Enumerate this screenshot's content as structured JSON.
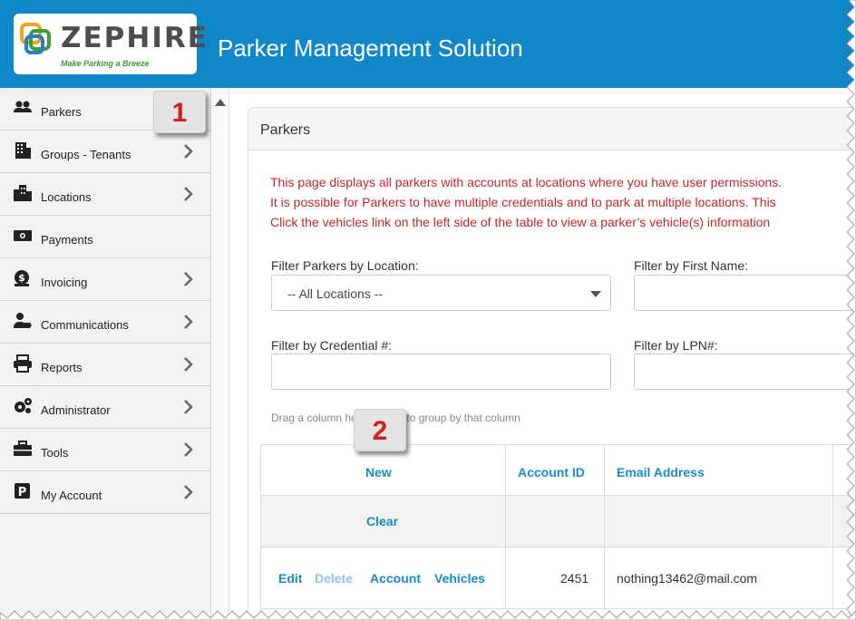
{
  "header": {
    "brand": "ZEPHIRE",
    "tagline": "Make Parking a Breeze",
    "title": "Parker Management Solution"
  },
  "sidebar": {
    "items": [
      {
        "label": "Parkers",
        "icon": "users-icon",
        "has_children": false
      },
      {
        "label": "Groups - Tenants",
        "icon": "building-icon",
        "has_children": true
      },
      {
        "label": "Locations",
        "icon": "city-icon",
        "has_children": true
      },
      {
        "label": "Payments",
        "icon": "money-icon",
        "has_children": false
      },
      {
        "label": "Invoicing",
        "icon": "invoice-dollar-icon",
        "has_children": true
      },
      {
        "label": "Communications",
        "icon": "user-tag-icon",
        "has_children": true
      },
      {
        "label": "Reports",
        "icon": "printer-icon",
        "has_children": true
      },
      {
        "label": "Administrator",
        "icon": "cogs-icon",
        "has_children": true
      },
      {
        "label": "Tools",
        "icon": "toolbox-icon",
        "has_children": true
      },
      {
        "label": "My Account",
        "icon": "parking-icon",
        "has_children": true
      }
    ]
  },
  "callouts": {
    "one": "1",
    "two": "2"
  },
  "panel": {
    "title": "Parkers",
    "notices": [
      "This page displays all parkers with accounts at locations where you have user permissions.",
      "It is possible for Parkers to have multiple credentials and to park at multiple locations. This",
      "Click the vehicles link on the left side of the table to view a parker’s vehicle(s) information"
    ],
    "filters": {
      "location_label": "Filter Parkers by Location:",
      "location_value": "-- All Locations --",
      "first_name_label": "Filter by First Name:",
      "first_name_value": "",
      "credential_label": "Filter by Credential #:",
      "credential_value": "",
      "lpn_label": "Filter by LPN#:",
      "lpn_value": ""
    },
    "group_hint": "Drag a column header here to group by that column",
    "grid": {
      "new_label": "New",
      "clear_label": "Clear",
      "columns": [
        "Account ID",
        "Email Address"
      ],
      "rows": [
        {
          "actions": [
            "Edit",
            "Delete",
            "Account",
            "Vehicles"
          ],
          "account_id": "2451",
          "email": "nothing13462@mail.com"
        }
      ]
    }
  },
  "colors": {
    "header_bg": "#0f87c8",
    "link": "#1a8bc8",
    "notice": "#c0272d",
    "callout_text": "#d11f1f"
  }
}
